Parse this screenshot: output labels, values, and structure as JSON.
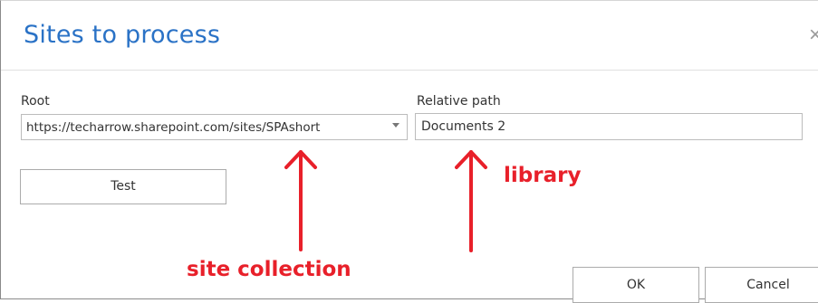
{
  "dialog": {
    "title": "Sites to process",
    "close_glyph": "×"
  },
  "fields": {
    "root_label": "Root",
    "root_value": "https://techarrow.sharepoint.com/sites/SPAshort",
    "relative_path_label": "Relative path",
    "relative_path_value": "Documents 2"
  },
  "buttons": {
    "test": "Test",
    "ok": "OK",
    "cancel": "Cancel"
  },
  "annotations": {
    "library": "library",
    "site_collection": "site collection",
    "color": "#e8202a"
  },
  "colors": {
    "title": "#2a72c6",
    "border": "#bcbcbc"
  }
}
